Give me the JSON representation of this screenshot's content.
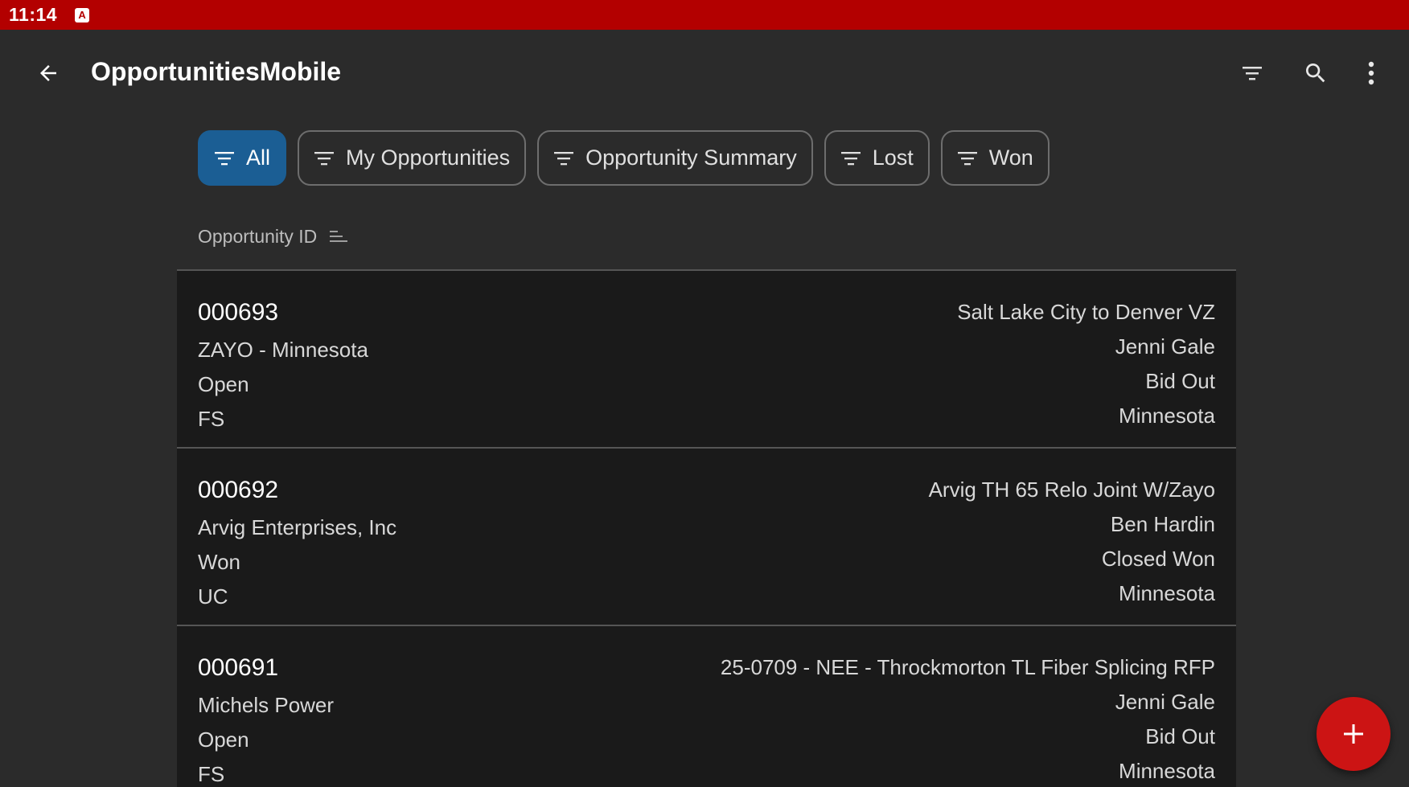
{
  "status_bar": {
    "time": "11:14",
    "app_icon_glyph": "A"
  },
  "app_bar": {
    "title": "OpportunitiesMobile",
    "icons": [
      "back-arrow-icon",
      "filter-icon",
      "search-icon",
      "more-vertical-icon"
    ]
  },
  "chips": [
    {
      "label": "All",
      "active": true
    },
    {
      "label": "My Opportunities",
      "active": false
    },
    {
      "label": "Opportunity Summary",
      "active": false
    },
    {
      "label": "Lost",
      "active": false
    },
    {
      "label": "Won",
      "active": false
    }
  ],
  "sort": {
    "label": "Opportunity ID"
  },
  "records": [
    {
      "id": "000693",
      "account": "ZAYO - Minnesota",
      "status": "Open",
      "type": "FS",
      "name": "Salt Lake City to Denver VZ",
      "owner": "Jenni Gale",
      "stage": "Bid Out",
      "region": "Minnesota"
    },
    {
      "id": "000692",
      "account": "Arvig Enterprises, Inc",
      "status": "Won",
      "type": "UC",
      "name": "Arvig TH 65 Relo Joint W/Zayo",
      "owner": "Ben Hardin",
      "stage": "Closed Won",
      "region": "Minnesota"
    },
    {
      "id": "000691",
      "account": "Michels Power",
      "status": "Open",
      "type": "FS",
      "name": "25-0709 - NEE - Throckmorton TL Fiber Splicing RFP",
      "owner": "Jenni Gale",
      "stage": "Bid Out",
      "region": "Minnesota"
    }
  ],
  "fab": {
    "icon": "plus-icon"
  },
  "colors": {
    "status_bar": "#b30000",
    "background": "#2b2b2b",
    "card": "#1a1a1a",
    "chip_active": "#1b5e94",
    "fab": "#cc1414"
  }
}
